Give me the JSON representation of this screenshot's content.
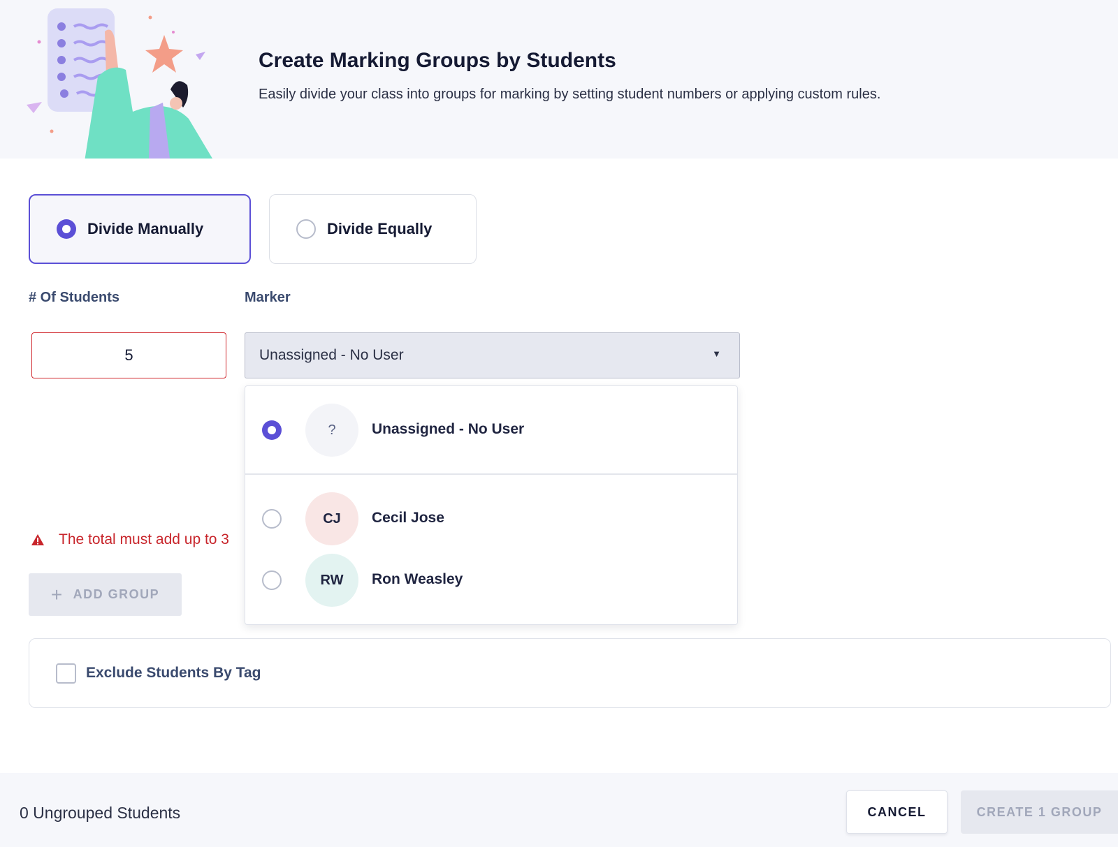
{
  "header": {
    "title": "Create Marking Groups by Students",
    "subtitle": "Easily divide your class into groups for marking by setting student numbers or applying custom rules."
  },
  "modes": {
    "manual_label": "Divide Manually",
    "equal_label": "Divide Equally",
    "selected": "manual"
  },
  "fields": {
    "students_label": "# Of Students",
    "marker_label": "Marker",
    "students_value": "5",
    "marker_value": "Unassigned - No User"
  },
  "dropdown": {
    "options": [
      {
        "initials": "?",
        "label": "Unassigned - No User",
        "selected": true,
        "avatar_color": "#f3f4f8"
      },
      {
        "initials": "CJ",
        "label": "Cecil Jose",
        "selected": false,
        "avatar_color": "#f9e6e5"
      },
      {
        "initials": "RW",
        "label": "Ron Weasley",
        "selected": false,
        "avatar_color": "#e3f3f1"
      }
    ]
  },
  "error": {
    "message": "The total must add up to 3"
  },
  "actions": {
    "add_group_label": "ADD GROUP",
    "exclude_label": "Exclude Students By Tag",
    "cancel_label": "CANCEL",
    "create_label": "CREATE 1 GROUP"
  },
  "footer": {
    "ungrouped_text": "0 Ungrouped Students"
  },
  "colors": {
    "accent": "#5b4fd6",
    "error": "#c8252b",
    "disabled_text": "#a1a7ba"
  }
}
